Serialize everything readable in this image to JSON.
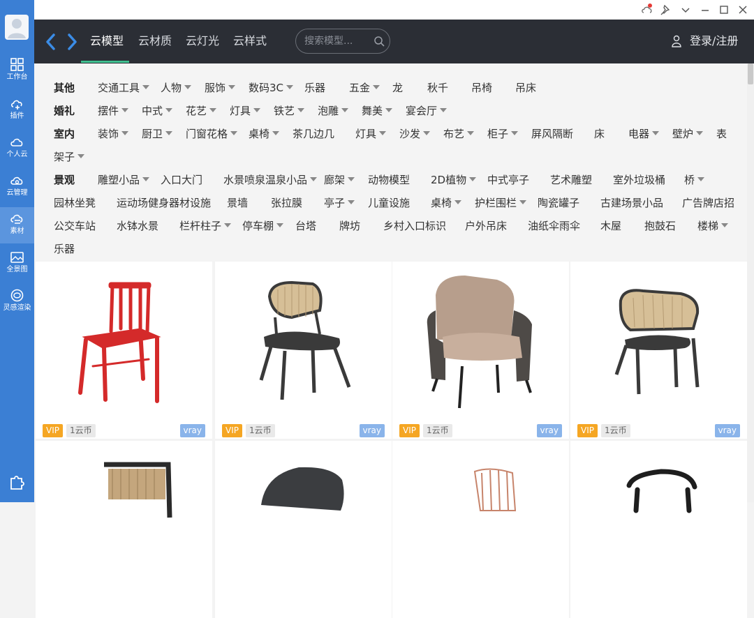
{
  "sidebar": {
    "items": [
      {
        "label": "工作台",
        "icon": "grid-icon"
      },
      {
        "label": "插件",
        "icon": "cloud-plugin-icon"
      },
      {
        "label": "个人云",
        "icon": "personal-cloud-icon"
      },
      {
        "label": "云管理",
        "icon": "cloud-manage-icon"
      },
      {
        "label": "素材",
        "icon": "material-icon"
      },
      {
        "label": "全景图",
        "icon": "panorama-icon"
      },
      {
        "label": "灵感渲染",
        "icon": "inspiration-render-icon"
      }
    ],
    "active_index": 4
  },
  "nav": {
    "tabs": [
      "云模型",
      "云材质",
      "云灯光",
      "云样式"
    ],
    "active_tab": 0,
    "search_placeholder": "搜索模型...",
    "login_label": "登录/注册"
  },
  "categories": {
    "rows": [
      {
        "label": "其他",
        "items": [
          {
            "text": "交通工具",
            "dd": true
          },
          {
            "text": "人物",
            "dd": true
          },
          {
            "text": "服饰",
            "dd": true
          },
          {
            "text": "数码3C",
            "dd": true
          },
          {
            "text": "乐器",
            "dd": false
          },
          {
            "text": "五金",
            "dd": true
          },
          {
            "text": "龙",
            "dd": false
          },
          {
            "text": "秋千",
            "dd": false
          },
          {
            "text": "吊椅",
            "dd": false
          },
          {
            "text": "吊床",
            "dd": false
          }
        ]
      },
      {
        "label": "婚礼",
        "items": [
          {
            "text": "摆件",
            "dd": true
          },
          {
            "text": "中式",
            "dd": true
          },
          {
            "text": "花艺",
            "dd": true
          },
          {
            "text": "灯具",
            "dd": true
          },
          {
            "text": "铁艺",
            "dd": true
          },
          {
            "text": "泡雕",
            "dd": true
          },
          {
            "text": "舞美",
            "dd": true
          },
          {
            "text": "宴会厅",
            "dd": true
          }
        ]
      },
      {
        "label": "室内",
        "items": [
          {
            "text": "装饰",
            "dd": true
          },
          {
            "text": "厨卫",
            "dd": true
          },
          {
            "text": "门窗花格",
            "dd": true
          },
          {
            "text": "桌椅",
            "dd": true
          },
          {
            "text": "茶几边几",
            "dd": false
          },
          {
            "text": "灯具",
            "dd": true
          },
          {
            "text": "沙发",
            "dd": true
          },
          {
            "text": "布艺",
            "dd": true
          },
          {
            "text": "柜子",
            "dd": true
          },
          {
            "text": "屏风隔断",
            "dd": false
          },
          {
            "text": "床",
            "dd": false
          },
          {
            "text": "电器",
            "dd": true
          },
          {
            "text": "壁炉",
            "dd": true
          },
          {
            "text": "表",
            "dd": false
          },
          {
            "text": "架子",
            "dd": true
          }
        ]
      },
      {
        "label": "景观",
        "items": [
          {
            "text": "雕塑小品",
            "dd": true
          },
          {
            "text": "入口大门",
            "dd": false
          },
          {
            "text": "水景喷泉温泉小品",
            "dd": true
          },
          {
            "text": "廊架",
            "dd": true
          },
          {
            "text": "动物模型",
            "dd": false
          },
          {
            "text": "2D植物",
            "dd": true
          },
          {
            "text": "中式亭子",
            "dd": false
          },
          {
            "text": "艺术雕塑",
            "dd": false
          },
          {
            "text": "室外垃圾桶",
            "dd": false
          },
          {
            "text": "桥",
            "dd": true
          },
          {
            "text": "园林坐凳",
            "dd": false
          },
          {
            "text": "运动场健身器材设施",
            "dd": false
          },
          {
            "text": "景墙",
            "dd": false
          },
          {
            "text": "张拉膜",
            "dd": false
          },
          {
            "text": "亭子",
            "dd": true
          },
          {
            "text": "儿童设施",
            "dd": false
          },
          {
            "text": "桌椅",
            "dd": true
          },
          {
            "text": "护栏围栏",
            "dd": true
          },
          {
            "text": "陶瓷罐子",
            "dd": false
          },
          {
            "text": "古建场景小品",
            "dd": false
          },
          {
            "text": "广告牌店招",
            "dd": false
          },
          {
            "text": "公交车站",
            "dd": false
          },
          {
            "text": "水钵水景",
            "dd": false
          },
          {
            "text": "栏杆柱子",
            "dd": true
          },
          {
            "text": "停车棚",
            "dd": true
          },
          {
            "text": "台塔",
            "dd": false
          },
          {
            "text": "牌坊",
            "dd": false
          },
          {
            "text": "乡村入口标识",
            "dd": false
          },
          {
            "text": "户外吊床",
            "dd": false
          },
          {
            "text": "油纸伞雨伞",
            "dd": false
          },
          {
            "text": "木屋",
            "dd": false
          },
          {
            "text": "抱鼓石",
            "dd": false
          },
          {
            "text": "楼梯",
            "dd": true
          },
          {
            "text": "乐器",
            "dd": false
          }
        ]
      }
    ]
  },
  "models": [
    {
      "vip": "VIP",
      "price": "1云币",
      "renderer": "vray",
      "color": "#d42a2a"
    },
    {
      "vip": "VIP",
      "price": "1云币",
      "renderer": "vray",
      "color": "#3a3a3a"
    },
    {
      "vip": "VIP",
      "price": "1云币",
      "renderer": "vray",
      "color": "#b79e8c"
    },
    {
      "vip": "VIP",
      "price": "1云币",
      "renderer": "vray",
      "color": "#3a3a3a"
    },
    {
      "color": "#2a2a2a"
    },
    {
      "color": "#3b3d40"
    },
    {
      "color": "#c7846b"
    },
    {
      "color": "#1e1e1e"
    }
  ],
  "colors": {
    "sidebar": "#3b7fd4",
    "nav": "#2b2e35",
    "accent_green": "#3fbf8f",
    "vip": "#f5a623",
    "vray": "#8ab4ea"
  }
}
